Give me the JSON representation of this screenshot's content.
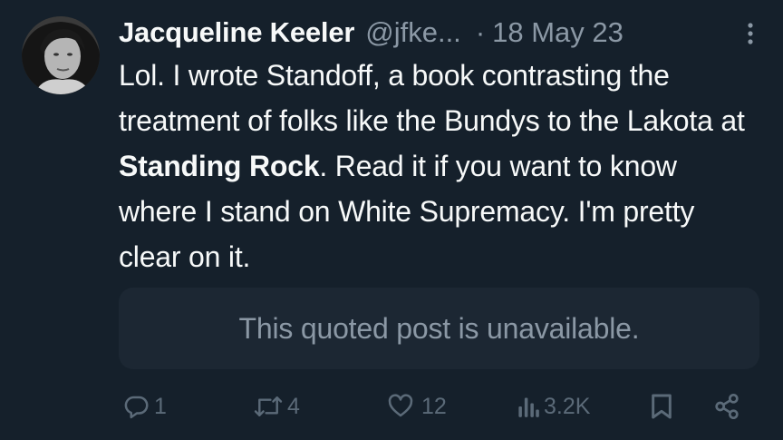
{
  "post": {
    "author_name": "Jacqueline Keeler",
    "author_handle": "@jfke...",
    "separator": "·",
    "date": "18 May 23",
    "text_part1": "Lol. I wrote Standoff, a book contrasting the treatment of folks like the Bundys to the Lakota at ",
    "text_bold": "Standing Rock",
    "text_part2": ". Read it if you want to know where I stand on White Supremacy. I'm pretty clear on it.",
    "quoted_notice": "This quoted post is unavailable."
  },
  "actions": {
    "replies": "1",
    "reposts": "4",
    "likes": "12",
    "views": "3.2K"
  },
  "icons": {
    "reply": "reply-icon",
    "repost": "repost-icon",
    "like": "heart-icon",
    "views": "views-icon",
    "bookmark": "bookmark-icon",
    "share": "share-icon",
    "more": "more-icon"
  },
  "colors": {
    "background": "#15202b",
    "text": "#f7f9f9",
    "muted": "#8b98a5",
    "actions": "#5b6a78",
    "quote_background": "#1c2733"
  }
}
